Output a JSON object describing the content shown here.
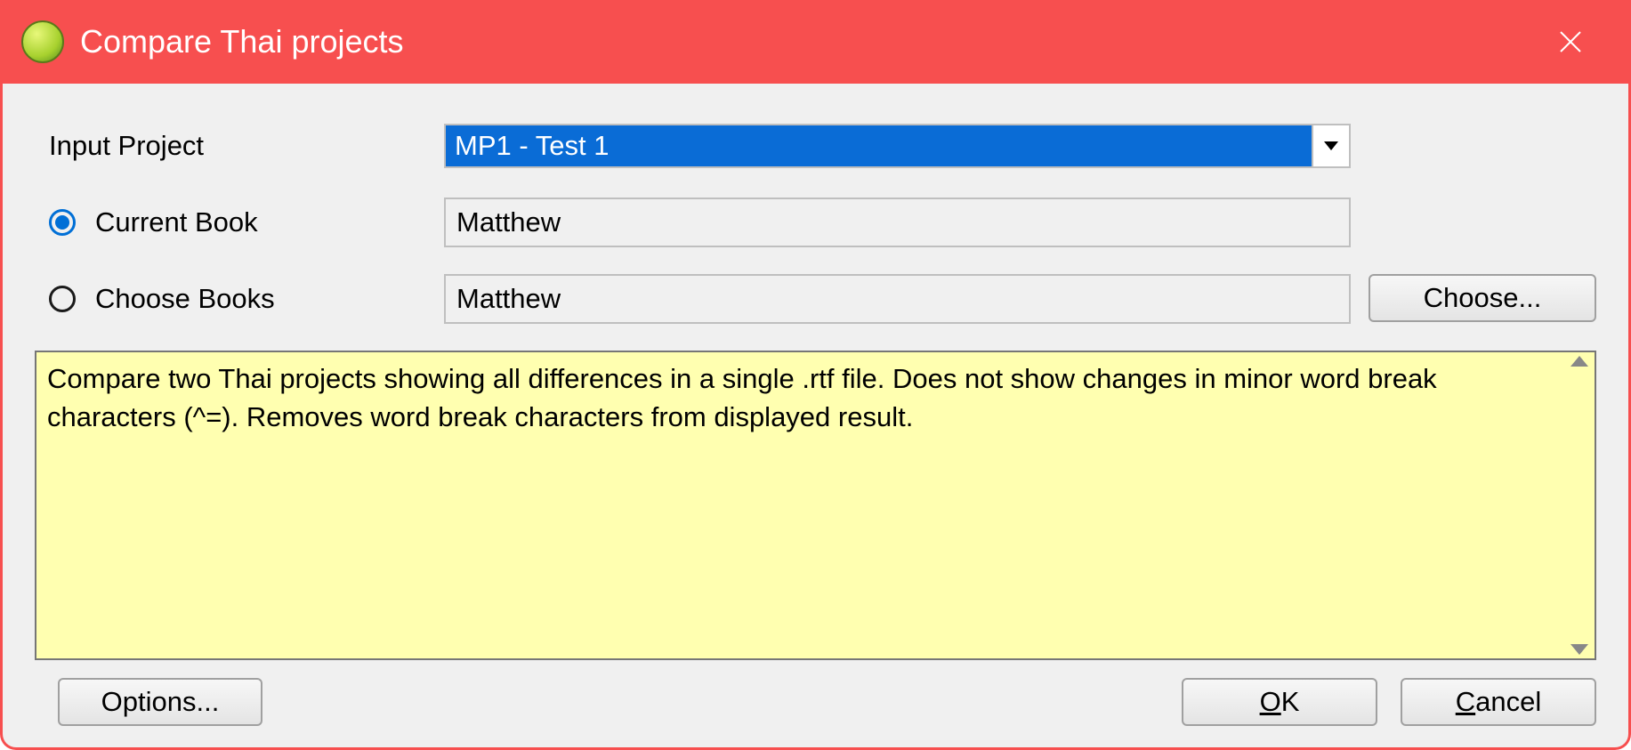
{
  "title": "Compare Thai projects",
  "form": {
    "input_project_label": "Input Project",
    "input_project_value": "MP1 -  Test 1",
    "current_book_label": "Current Book",
    "current_book_value": "Matthew",
    "choose_books_label": "Choose Books",
    "choose_books_value": "Matthew",
    "choose_button": "Choose...",
    "book_mode_selected": "current"
  },
  "description": "Compare two Thai projects showing all differences in a single .rtf file. Does not show changes in minor word break characters (^=). Removes word break characters from displayed result.",
  "footer": {
    "options": "Options...",
    "ok_pre": "",
    "ok_u": "O",
    "ok_post": "K",
    "cancel_pre": "",
    "cancel_u": "C",
    "cancel_post": "ancel"
  }
}
